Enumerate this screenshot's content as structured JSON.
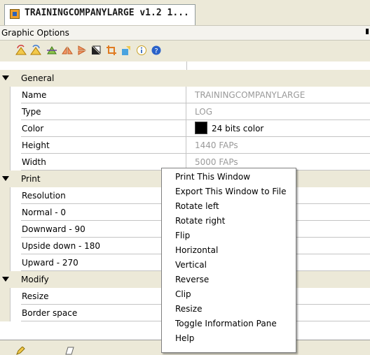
{
  "tab": {
    "title": "TRAININGCOMPANYLARGE v1.2 1...",
    "icon": "document-icon"
  },
  "panel": {
    "title": "Graphic Options"
  },
  "toolbar": {
    "icons": [
      "rotate-left-icon",
      "rotate-right-icon",
      "flip-icon",
      "horizontal-icon",
      "vertical-icon",
      "reverse-icon",
      "clip-icon",
      "resize-icon",
      "info-icon",
      "help-icon"
    ]
  },
  "categories": {
    "general": "General",
    "print": "Print",
    "modify": "Modify"
  },
  "general": {
    "name_label": "Name",
    "name_value": "TRAININGCOMPANYLARGE",
    "type_label": "Type",
    "type_value": "LOG",
    "color_label": "Color",
    "color_value": "24 bits color",
    "color_swatch": "#000000",
    "height_label": "Height",
    "height_value": "1440 FAPs",
    "width_label": "Width",
    "width_value": "5000 FAPs"
  },
  "print": {
    "resolution_label": "Resolution",
    "normal_label": "Normal - 0",
    "downward_label": "Downward - 90",
    "upside_label": "Upside down - 180",
    "upward_label": "Upward - 270"
  },
  "modify": {
    "resize_label": "Resize",
    "border_label": "Border space"
  },
  "context_menu": {
    "items": [
      "Print This Window",
      "Export This Window to File",
      "Rotate left",
      "Rotate right",
      "Flip",
      "Horizontal",
      "Vertical",
      "Reverse",
      "Clip",
      "Resize",
      "Toggle Information Pane",
      "Help"
    ]
  },
  "colors": {
    "window_bg": "#ece9d8",
    "grid_line": "#c4c4c4",
    "value_text": "#9a9a9a"
  }
}
